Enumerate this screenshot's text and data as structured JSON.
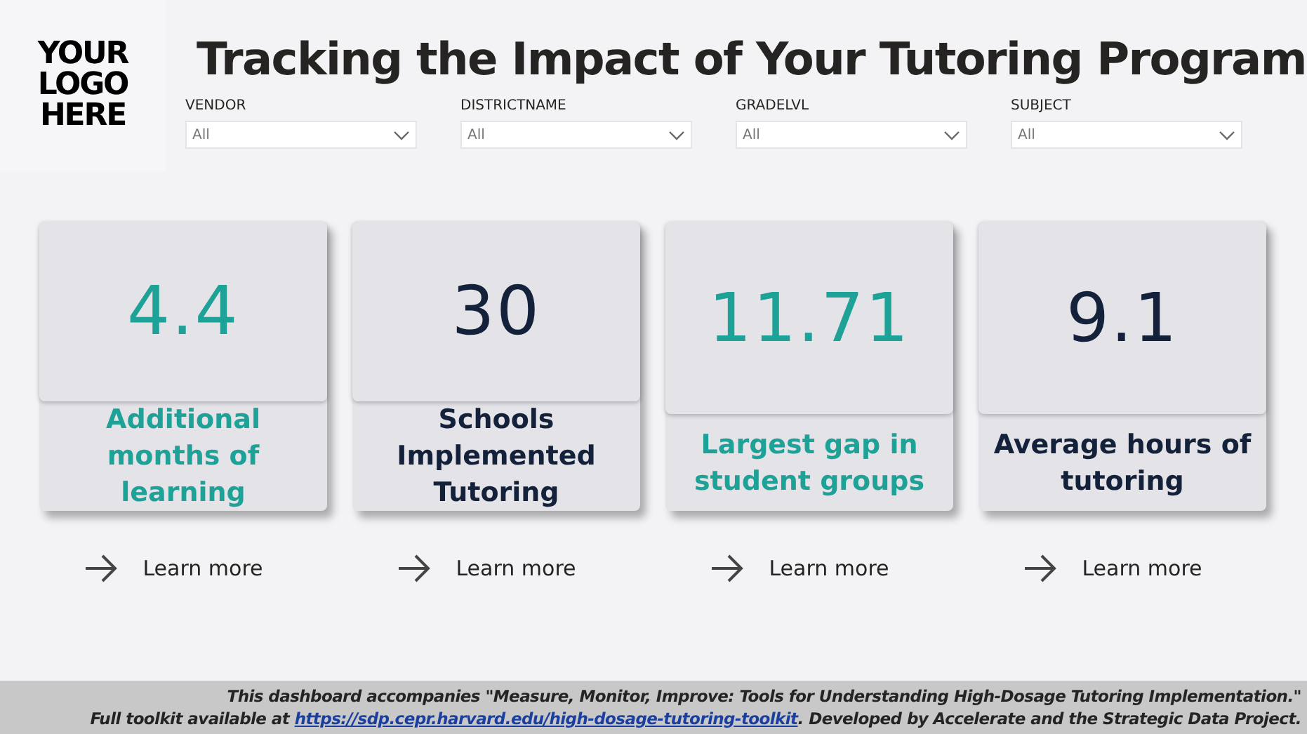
{
  "logo": {
    "text": "YOUR LOGO HERE"
  },
  "title": "Tracking the Impact of Your Tutoring Program",
  "filters": [
    {
      "label": "VENDOR",
      "value": "All"
    },
    {
      "label": "DISTRICTNAME",
      "value": "All"
    },
    {
      "label": "GRADELVL",
      "value": "All"
    },
    {
      "label": "SUBJECT",
      "value": "All"
    }
  ],
  "cards": [
    {
      "value": "4.4",
      "caption": "Additional months of learning",
      "color": "#1ea196",
      "link": "Learn more"
    },
    {
      "value": "30",
      "caption": "Schools Implemented Tutoring",
      "color": "#14213a",
      "link": "Learn more"
    },
    {
      "value": "11.71",
      "caption": "Largest gap in student groups",
      "color": "#1ea196",
      "link": "Learn more"
    },
    {
      "value": "9.1",
      "caption": "Average hours of tutoring",
      "color": "#14213a",
      "link": "Learn more"
    }
  ],
  "footer": {
    "line_1": "This dashboard accompanies \"Measure, Monitor, Improve: Tools for Understanding High-Dosage Tutoring Implementation.\"",
    "line_2_before": "Full toolkit available at ",
    "link": "https://sdp.cepr.harvard.edu/high-dosage-tutoring-toolkit",
    "line_2_after": ". Developed by Accelerate and the Strategic Data Project."
  }
}
